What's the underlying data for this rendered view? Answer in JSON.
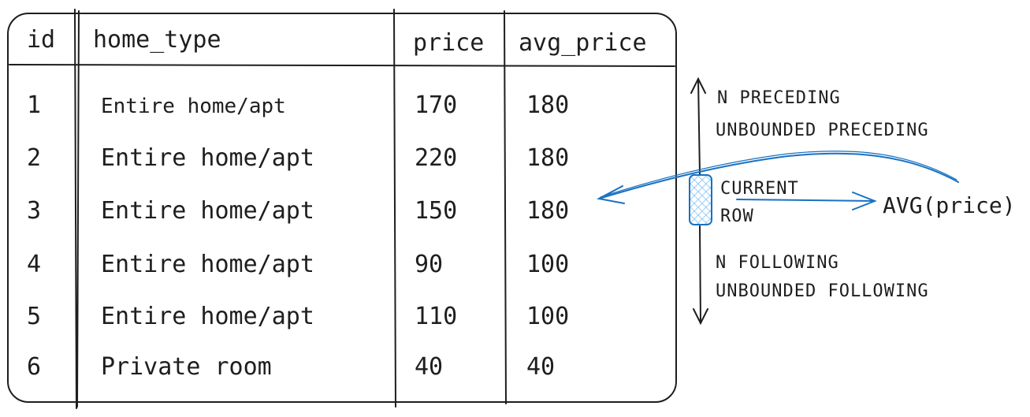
{
  "table": {
    "headers": [
      "id",
      "home_type",
      "price",
      "avg_price"
    ],
    "rows": [
      [
        "1",
        "Entire home/apt",
        "170",
        "180"
      ],
      [
        "2",
        "Entire home/apt",
        "220",
        "180"
      ],
      [
        "3",
        "Entire home/apt",
        "150",
        "180"
      ],
      [
        "4",
        "Entire home/apt",
        "90",
        "100"
      ],
      [
        "5",
        "Entire home/apt",
        "110",
        "100"
      ],
      [
        "6",
        "Private room",
        "40",
        "40"
      ]
    ]
  },
  "frame": {
    "n_preceding": "N PRECEDING",
    "unbounded_preceding": "UNBOUNDED PRECEDING",
    "current_row_line1": "CURRENT",
    "current_row_line2": "ROW",
    "n_following": "N FOLLOWING",
    "unbounded_following": "UNBOUNDED FOLLOWING",
    "aggregate": "AVG(price)"
  },
  "colors": {
    "ink": "#1e1e1e",
    "accent": "#1971c2",
    "highlight_fill": "#a5d8ff"
  }
}
